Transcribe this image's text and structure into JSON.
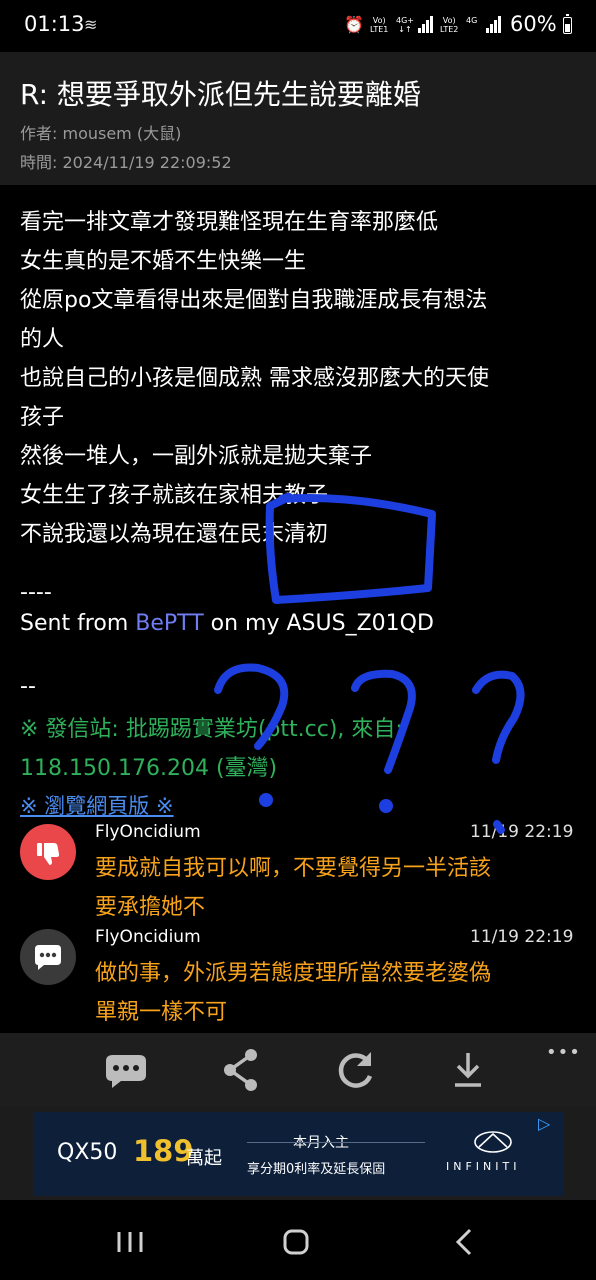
{
  "status_bar": {
    "time": "01:13",
    "sim1_top": "Vo)",
    "sim1_bottom": "LTE1",
    "net1_top": "4G+",
    "net1_bottom": "↓↑",
    "sim2_top": "Vo)",
    "sim2_bottom": "LTE2",
    "net2_top": "4G",
    "battery": "60%"
  },
  "article": {
    "title": "R: 想要爭取外派但先生說要離婚",
    "author_label": "作者: ",
    "author": "mousem (大鼠)",
    "time_label": "時間: ",
    "time": "2024/11/19 22:09:52",
    "body_lines": [
      "看完一排文章才發現難怪現在生育率那麼低",
      "女生真的是不婚不生快樂一生",
      "從原po文章看得出來是個對自我職涯成長有想法",
      "的人",
      "也說自己的小孩是個成熟 需求感沒那麼大的天使",
      "孩子",
      "然後一堆人，一副外派就是拋夫棄子",
      "女生生了孩子就該在家相夫教子",
      "不說我還以為現在還在民末清初"
    ],
    "sig_separator": "----",
    "sent_from_prefix": "Sent from ",
    "sent_from_app": "BePTT",
    "sent_from_suffix": " on my ASUS_Z01QD",
    "footer_separator": "--",
    "source_line1": "※ 發信站: 批踢踢實業坊(ptt.cc), 來自:",
    "source_line2": "118.150.176.204 (臺灣)",
    "web_link": "※ 瀏覽網頁版 ※"
  },
  "comments": [
    {
      "type": "boo",
      "icon": "thumbs-down-icon",
      "user": "FlyOncidium",
      "time": "11/19 22:19",
      "lines": [
        "要成就自我可以啊，不要覺得另一半活該",
        "要承擔她不"
      ]
    },
    {
      "type": "arrow",
      "icon": "chat-bubble-icon",
      "user": "FlyOncidium",
      "time": "11/19 22:19",
      "lines": [
        "做的事，外派男若態度理所當然要老婆偽",
        "單親一樣不可"
      ]
    }
  ],
  "toolbar": {
    "buttons": [
      "comment-icon",
      "share-icon",
      "refresh-icon",
      "download-icon"
    ],
    "more": "•••"
  },
  "ad": {
    "model": "QX50",
    "price": "189",
    "price_unit": "萬起",
    "line1": "本月入主",
    "line2": "享分期0利率及延長保固",
    "brand": "INFINITI",
    "badge": "▷"
  },
  "colors": {
    "accent_link": "#6f7cf2",
    "source_green": "#2fb15b",
    "comment_text": "#f7a21b",
    "boo_red": "#e9474a",
    "ink_blue": "#1d3fe0"
  }
}
